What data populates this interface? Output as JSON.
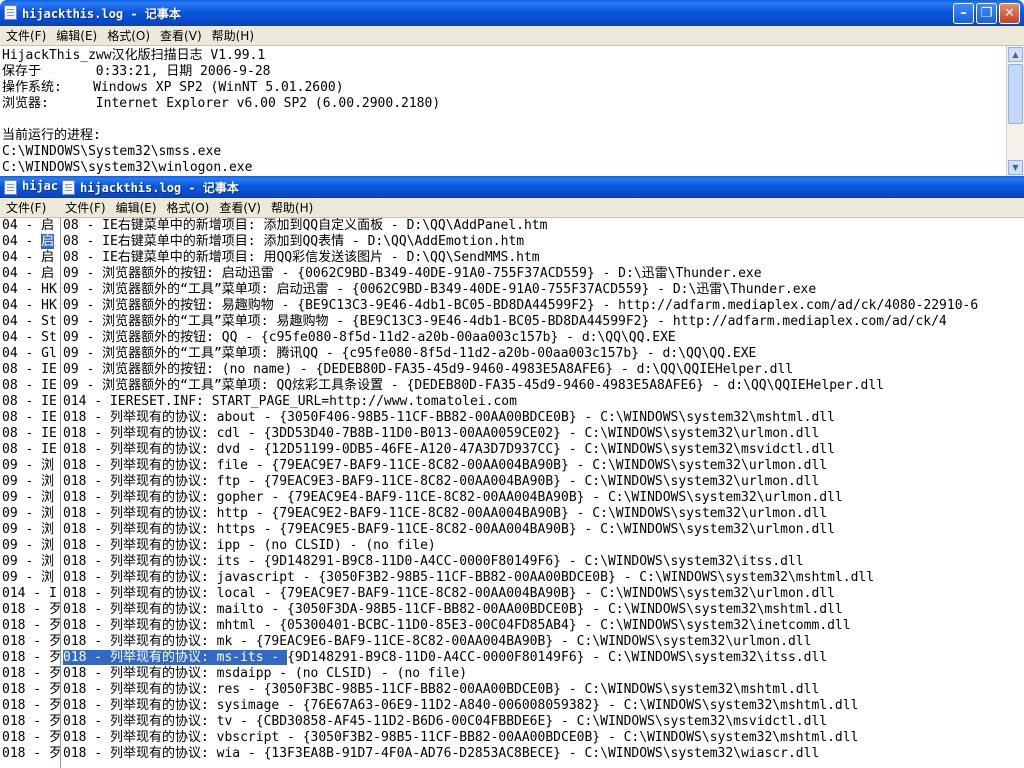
{
  "window_top": {
    "title": "hijackthis.log - 记事本",
    "menu": [
      "文件(F)",
      "编辑(E)",
      "格式(O)",
      "查看(V)",
      "帮助(H)"
    ],
    "lines": [
      "HijackThis_zww汉化版扫描日志 V1.99.1",
      "保存于       0:33:21, 日期 2006-9-28",
      "操作系统:    Windows XP SP2 (WinNT 5.01.2600)",
      "浏览器:      Internet Explorer v6.00 SP2 (6.00.2900.2180)",
      "",
      "当前运行的进程:",
      "C:\\WINDOWS\\System32\\smss.exe",
      "C:\\WINDOWS\\system32\\winlogon.exe"
    ]
  },
  "window_bottom": {
    "title": "hijackthis.log - 记事本",
    "behind_title": "hijac",
    "menu": [
      "文件(F)",
      "文件(F)",
      "编辑(E)",
      "格式(O)",
      "查看(V)",
      "帮助(H)"
    ],
    "left_lines": [
      "04 - 启",
      "04 - 启",
      "04 - 启",
      "04 - 启",
      "04 - HK",
      "04 - HK",
      "04 - St",
      "04 - St",
      "04 - Gl",
      "08 - IE",
      "08 - IE",
      "08 - IE",
      "08 - IE",
      "08 - IE",
      "08 - IE",
      "09 - 浏",
      "09 - 浏",
      "09 - 浏",
      "09 - 浏",
      "09 - 浏",
      "09 - 浏",
      "09 - 浏",
      "09 - 浏",
      "014 - I",
      "018 - 歹",
      "018 - 歹",
      "018 - 歹",
      "018 - 歹",
      "018 - 歹",
      "018 - 歹",
      "018 - 歹",
      "018 - 歹",
      "018 - 歹",
      "018 - 歹"
    ],
    "lines": [
      "08 - IE右键菜单中的新增项目: 添加到QQ自定义面板 - D:\\QQ\\AddPanel.htm",
      "08 - IE右键菜单中的新增项目: 添加到QQ表情 - D:\\QQ\\AddEmotion.htm",
      "08 - IE右键菜单中的新增项目: 用QQ彩信发送该图片 - D:\\QQ\\SendMMS.htm",
      "09 - 浏览器额外的按钮: 启动迅雷 - {0062C9BD-B349-40DE-91A0-755F37ACD559} - D:\\迅雷\\Thunder.exe",
      "09 - 浏览器额外的“工具”菜单项: 启动迅雷 - {0062C9BD-B349-40DE-91A0-755F37ACD559} - D:\\迅雷\\Thunder.exe",
      "09 - 浏览器额外的按钮: 易趣购物 - {BE9C13C3-9E46-4db1-BC05-BD8DA44599F2} - http://adfarm.mediaplex.com/ad/ck/4080-22910-6",
      "09 - 浏览器额外的“工具”菜单项: 易趣购物 - {BE9C13C3-9E46-4db1-BC05-BD8DA44599F2} - http://adfarm.mediaplex.com/ad/ck/4",
      "09 - 浏览器额外的按钮: QQ - {c95fe080-8f5d-11d2-a20b-00aa003c157b} - d:\\QQ\\QQ.EXE",
      "09 - 浏览器额外的“工具”菜单项: 腾讯QQ - {c95fe080-8f5d-11d2-a20b-00aa003c157b} - d:\\QQ\\QQ.EXE",
      "09 - 浏览器额外的按钮: (no name) - {DEDEB80D-FA35-45d9-9460-4983E5A8AFE6} - d:\\QQ\\QQIEHelper.dll",
      "09 - 浏览器额外的“工具”菜单项: QQ炫彩工具条设置 - {DEDEB80D-FA35-45d9-9460-4983E5A8AFE6} - d:\\QQ\\QQIEHelper.dll",
      "014 - IERESET.INF: START_PAGE_URL=http://www.tomatolei.com",
      "018 - 列举现有的协议: about - {3050F406-98B5-11CF-BB82-00AA00BDCE0B} - C:\\WINDOWS\\system32\\mshtml.dll",
      "018 - 列举现有的协议: cdl - {3DD53D40-7B8B-11D0-B013-00AA0059CE02} - C:\\WINDOWS\\system32\\urlmon.dll",
      "018 - 列举现有的协议: dvd - {12D51199-0DB5-46FE-A120-47A3D7D937CC} - C:\\WINDOWS\\system32\\msvidctl.dll",
      "018 - 列举现有的协议: file - {79EAC9E7-BAF9-11CE-8C82-00AA004BA90B} - C:\\WINDOWS\\system32\\urlmon.dll",
      "018 - 列举现有的协议: ftp - {79EAC9E3-BAF9-11CE-8C82-00AA004BA90B} - C:\\WINDOWS\\system32\\urlmon.dll",
      "018 - 列举现有的协议: gopher - {79EAC9E4-BAF9-11CE-8C82-00AA004BA90B} - C:\\WINDOWS\\system32\\urlmon.dll",
      "018 - 列举现有的协议: http - {79EAC9E2-BAF9-11CE-8C82-00AA004BA90B} - C:\\WINDOWS\\system32\\urlmon.dll",
      "018 - 列举现有的协议: https - {79EAC9E5-BAF9-11CE-8C82-00AA004BA90B} - C:\\WINDOWS\\system32\\urlmon.dll",
      "018 - 列举现有的协议: ipp - (no CLSID) - (no file)",
      "018 - 列举现有的协议: its - {9D148291-B9C8-11D0-A4CC-0000F80149F6} - C:\\WINDOWS\\system32\\itss.dll",
      "018 - 列举现有的协议: javascript - {3050F3B2-98B5-11CF-BB82-00AA00BDCE0B} - C:\\WINDOWS\\system32\\mshtml.dll",
      "018 - 列举现有的协议: local - {79EAC9E7-BAF9-11CE-8C82-00AA004BA90B} - C:\\WINDOWS\\system32\\urlmon.dll",
      "018 - 列举现有的协议: mailto - {3050F3DA-98B5-11CF-BB82-00AA00BDCE0B} - C:\\WINDOWS\\system32\\mshtml.dll",
      "018 - 列举现有的协议: mhtml - {05300401-BCBC-11D0-85E3-00C04FD85AB4} - C:\\WINDOWS\\system32\\inetcomm.dll",
      "018 - 列举现有的协议: mk - {79EAC9E6-BAF9-11CE-8C82-00AA004BA90B} - C:\\WINDOWS\\system32\\urlmon.dll",
      "018 - 列举现有的协议: ms-its - {9D148291-B9C8-11D0-A4CC-0000F80149F6} - C:\\WINDOWS\\system32\\itss.dll",
      "018 - 列举现有的协议: msdaipp - (no CLSID) - (no file)",
      "018 - 列举现有的协议: res - {3050F3BC-98B5-11CF-BB82-00AA00BDCE0B} - C:\\WINDOWS\\system32\\mshtml.dll",
      "018 - 列举现有的协议: sysimage - {76E67A63-06E9-11D2-A840-006008059382} - C:\\WINDOWS\\system32\\mshtml.dll",
      "018 - 列举现有的协议: tv - {CBD30858-AF45-11D2-B6D6-00C04FBBDE6E} - C:\\WINDOWS\\system32\\msvidctl.dll",
      "018 - 列举现有的协议: vbscript - {3050F3B2-98B5-11CF-BB82-00AA00BDCE0B} - C:\\WINDOWS\\system32\\mshtml.dll",
      "018 - 列举现有的协议: wia - {13F3EA8B-91D7-4F0A-AD76-D2853AC8BECE} - C:\\WINDOWS\\system32\\wiascr.dll"
    ]
  }
}
